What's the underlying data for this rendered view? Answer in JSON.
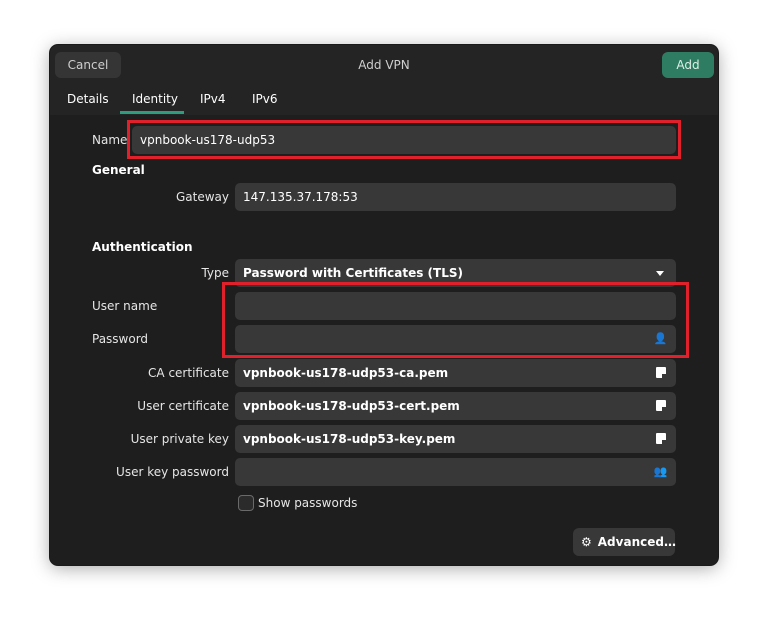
{
  "header": {
    "cancel_label": "Cancel",
    "title": "Add VPN",
    "add_label": "Add"
  },
  "tabs": [
    {
      "label": "Details"
    },
    {
      "label": "Identity"
    },
    {
      "label": "IPv4"
    },
    {
      "label": "IPv6"
    }
  ],
  "selected_tab": "Identity",
  "name": {
    "label": "Name",
    "value": "vpnbook-us178-udp53"
  },
  "general": {
    "heading": "General",
    "gateway_label": "Gateway",
    "gateway_value": "147.135.37.178:53"
  },
  "auth": {
    "heading": "Authentication",
    "type_label": "Type",
    "type_value": "Password with Certificates (TLS)",
    "username_label": "User name",
    "username_value": "",
    "password_label": "Password",
    "password_value": "",
    "ca_label": "CA certificate",
    "ca_value": "vpnbook-us178-udp53-ca.pem",
    "user_cert_label": "User certificate",
    "user_cert_value": "vpnbook-us178-udp53-cert.pem",
    "user_key_label": "User private key",
    "user_key_value": "vpnbook-us178-udp53-key.pem",
    "user_key_password_label": "User key password",
    "user_key_password_value": "",
    "show_passwords_label": "Show passwords"
  },
  "advanced_label": "Advanced…",
  "colors": {
    "accent": "#2e9c7f",
    "add_button": "#2e7d62",
    "highlight": "#e0202a"
  }
}
